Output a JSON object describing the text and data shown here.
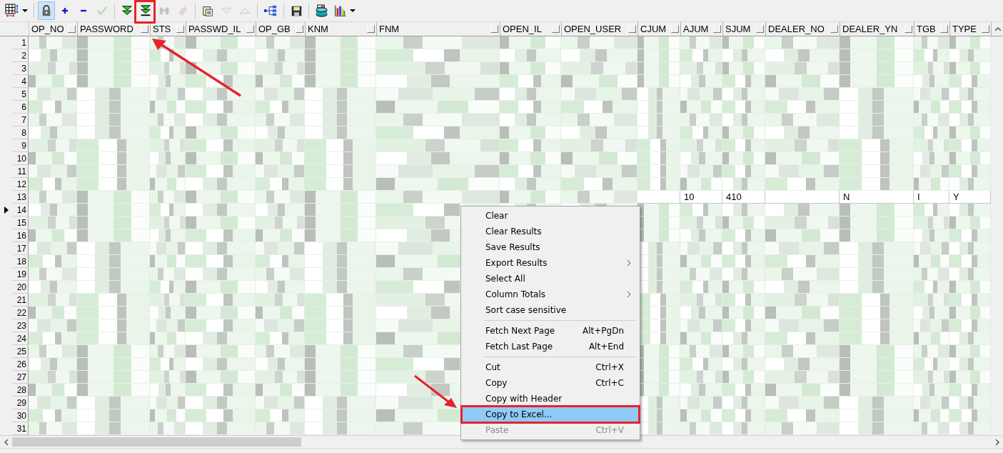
{
  "toolbar": [
    {
      "kind": "grid",
      "dropdown": true,
      "pressed": false,
      "disabled": false,
      "outlined": false
    },
    {
      "kind": "separator"
    },
    {
      "kind": "lock",
      "dropdown": false,
      "pressed": true,
      "disabled": false,
      "outlined": false
    },
    {
      "kind": "plus",
      "dropdown": false,
      "pressed": false,
      "disabled": false,
      "outlined": false
    },
    {
      "kind": "minus",
      "dropdown": false,
      "pressed": false,
      "disabled": false,
      "outlined": false
    },
    {
      "kind": "check",
      "dropdown": false,
      "pressed": false,
      "disabled": true,
      "outlined": false
    },
    {
      "kind": "separator"
    },
    {
      "kind": "fetch-next",
      "dropdown": false,
      "pressed": false,
      "disabled": false,
      "outlined": false
    },
    {
      "kind": "fetch-last",
      "dropdown": false,
      "pressed": false,
      "disabled": false,
      "outlined": true
    },
    {
      "kind": "binoculars",
      "dropdown": false,
      "pressed": false,
      "disabled": true,
      "outlined": false
    },
    {
      "kind": "eraser",
      "dropdown": false,
      "pressed": false,
      "disabled": true,
      "outlined": false
    },
    {
      "kind": "separator"
    },
    {
      "kind": "clipboard",
      "dropdown": false,
      "pressed": false,
      "disabled": false,
      "outlined": false
    },
    {
      "kind": "down",
      "dropdown": false,
      "pressed": false,
      "disabled": true,
      "outlined": false
    },
    {
      "kind": "up",
      "dropdown": false,
      "pressed": false,
      "disabled": true,
      "outlined": false
    },
    {
      "kind": "separator"
    },
    {
      "kind": "tree",
      "dropdown": false,
      "pressed": false,
      "disabled": false,
      "outlined": false
    },
    {
      "kind": "separator"
    },
    {
      "kind": "save",
      "dropdown": false,
      "pressed": false,
      "disabled": false,
      "outlined": false
    },
    {
      "kind": "separator"
    },
    {
      "kind": "database",
      "dropdown": false,
      "pressed": false,
      "disabled": false,
      "outlined": false
    },
    {
      "kind": "chart",
      "dropdown": true,
      "pressed": false,
      "disabled": false,
      "outlined": false
    }
  ],
  "columns": [
    "OP_NO",
    "PASSWORD",
    "STS",
    "PASSWD_IL",
    "OP_GB",
    "KNM",
    "FNM",
    "OPEN_IL",
    "OPEN_USER",
    "CJUM",
    "AJUM",
    "SJUM",
    "DEALER_NO",
    "DEALER_YN",
    "TGB",
    "TYPE"
  ],
  "rows": [
    {
      "number": "1",
      "current": false
    },
    {
      "number": "2",
      "current": false
    },
    {
      "number": "3",
      "current": false
    },
    {
      "number": "4",
      "current": false
    },
    {
      "number": "5",
      "current": false
    },
    {
      "number": "6",
      "current": false
    },
    {
      "number": "7",
      "current": false
    },
    {
      "number": "8",
      "current": false
    },
    {
      "number": "9",
      "current": false
    },
    {
      "number": "10",
      "current": false
    },
    {
      "number": "11",
      "current": false
    },
    {
      "number": "12",
      "current": false
    },
    {
      "number": "13",
      "current": false,
      "cells": [
        {
          "blurred": true
        },
        {
          "blurred": true
        },
        {
          "blurred": true
        },
        {
          "blurred": true
        },
        {
          "blurred": true
        },
        {
          "blurred": true
        },
        {
          "blurred": true
        },
        {
          "blurred": true
        },
        {
          "blurred": true
        },
        {
          "blurred": false
        },
        {
          "blurred": false,
          "text": "10"
        },
        {
          "blurred": false,
          "text": "410"
        },
        {
          "blurred": false
        },
        {
          "blurred": false,
          "text": "N"
        },
        {
          "blurred": false,
          "text": "I"
        },
        {
          "blurred": false,
          "text": "Y"
        }
      ]
    },
    {
      "number": "14",
      "current": true
    },
    {
      "number": "15",
      "current": false
    },
    {
      "number": "16",
      "current": false
    },
    {
      "number": "17",
      "current": false
    },
    {
      "number": "18",
      "current": false
    },
    {
      "number": "19",
      "current": false
    },
    {
      "number": "20",
      "current": false
    },
    {
      "number": "21",
      "current": false
    },
    {
      "number": "22",
      "current": false
    },
    {
      "number": "23",
      "current": false
    },
    {
      "number": "24",
      "current": false
    },
    {
      "number": "25",
      "current": false
    },
    {
      "number": "26",
      "current": false
    },
    {
      "number": "27",
      "current": false
    },
    {
      "number": "28",
      "current": false
    },
    {
      "number": "29",
      "current": false
    },
    {
      "number": "30",
      "current": false
    },
    {
      "number": "31",
      "current": false
    }
  ],
  "context_menu": [
    {
      "kind": "item",
      "label": "Clear",
      "submenu": false,
      "disabled": false,
      "selected": false,
      "outlined": false
    },
    {
      "kind": "item",
      "label": "Clear Results",
      "submenu": false,
      "disabled": false,
      "selected": false,
      "outlined": false
    },
    {
      "kind": "item",
      "label": "Save Results",
      "submenu": false,
      "disabled": false,
      "selected": false,
      "outlined": false
    },
    {
      "kind": "item",
      "label": "Export Results",
      "submenu": true,
      "disabled": false,
      "selected": false,
      "outlined": false
    },
    {
      "kind": "item",
      "label": "Select All",
      "submenu": false,
      "disabled": false,
      "selected": false,
      "outlined": false
    },
    {
      "kind": "item",
      "label": "Column Totals",
      "submenu": true,
      "disabled": false,
      "selected": false,
      "outlined": false
    },
    {
      "kind": "item",
      "label": "Sort case sensitive",
      "submenu": false,
      "disabled": false,
      "selected": false,
      "outlined": false
    },
    {
      "kind": "separator"
    },
    {
      "kind": "item",
      "label": "Fetch Next Page",
      "shortcut": "Alt+PgDn",
      "submenu": false,
      "disabled": false,
      "selected": false,
      "outlined": false
    },
    {
      "kind": "item",
      "label": "Fetch Last Page",
      "shortcut": "Alt+End",
      "submenu": false,
      "disabled": false,
      "selected": false,
      "outlined": false
    },
    {
      "kind": "separator"
    },
    {
      "kind": "item",
      "label": "Cut",
      "shortcut": "Ctrl+X",
      "submenu": false,
      "disabled": false,
      "selected": false,
      "outlined": false
    },
    {
      "kind": "item",
      "label": "Copy",
      "shortcut": "Ctrl+C",
      "submenu": false,
      "disabled": false,
      "selected": false,
      "outlined": false
    },
    {
      "kind": "item",
      "label": "Copy with Header",
      "submenu": false,
      "disabled": false,
      "selected": false,
      "outlined": false
    },
    {
      "kind": "item",
      "label": "Copy to Excel...",
      "submenu": false,
      "disabled": false,
      "selected": true,
      "outlined": true
    },
    {
      "kind": "item",
      "label": "Paste",
      "shortcut": "Ctrl+V",
      "submenu": false,
      "disabled": true,
      "selected": false,
      "outlined": false
    }
  ]
}
